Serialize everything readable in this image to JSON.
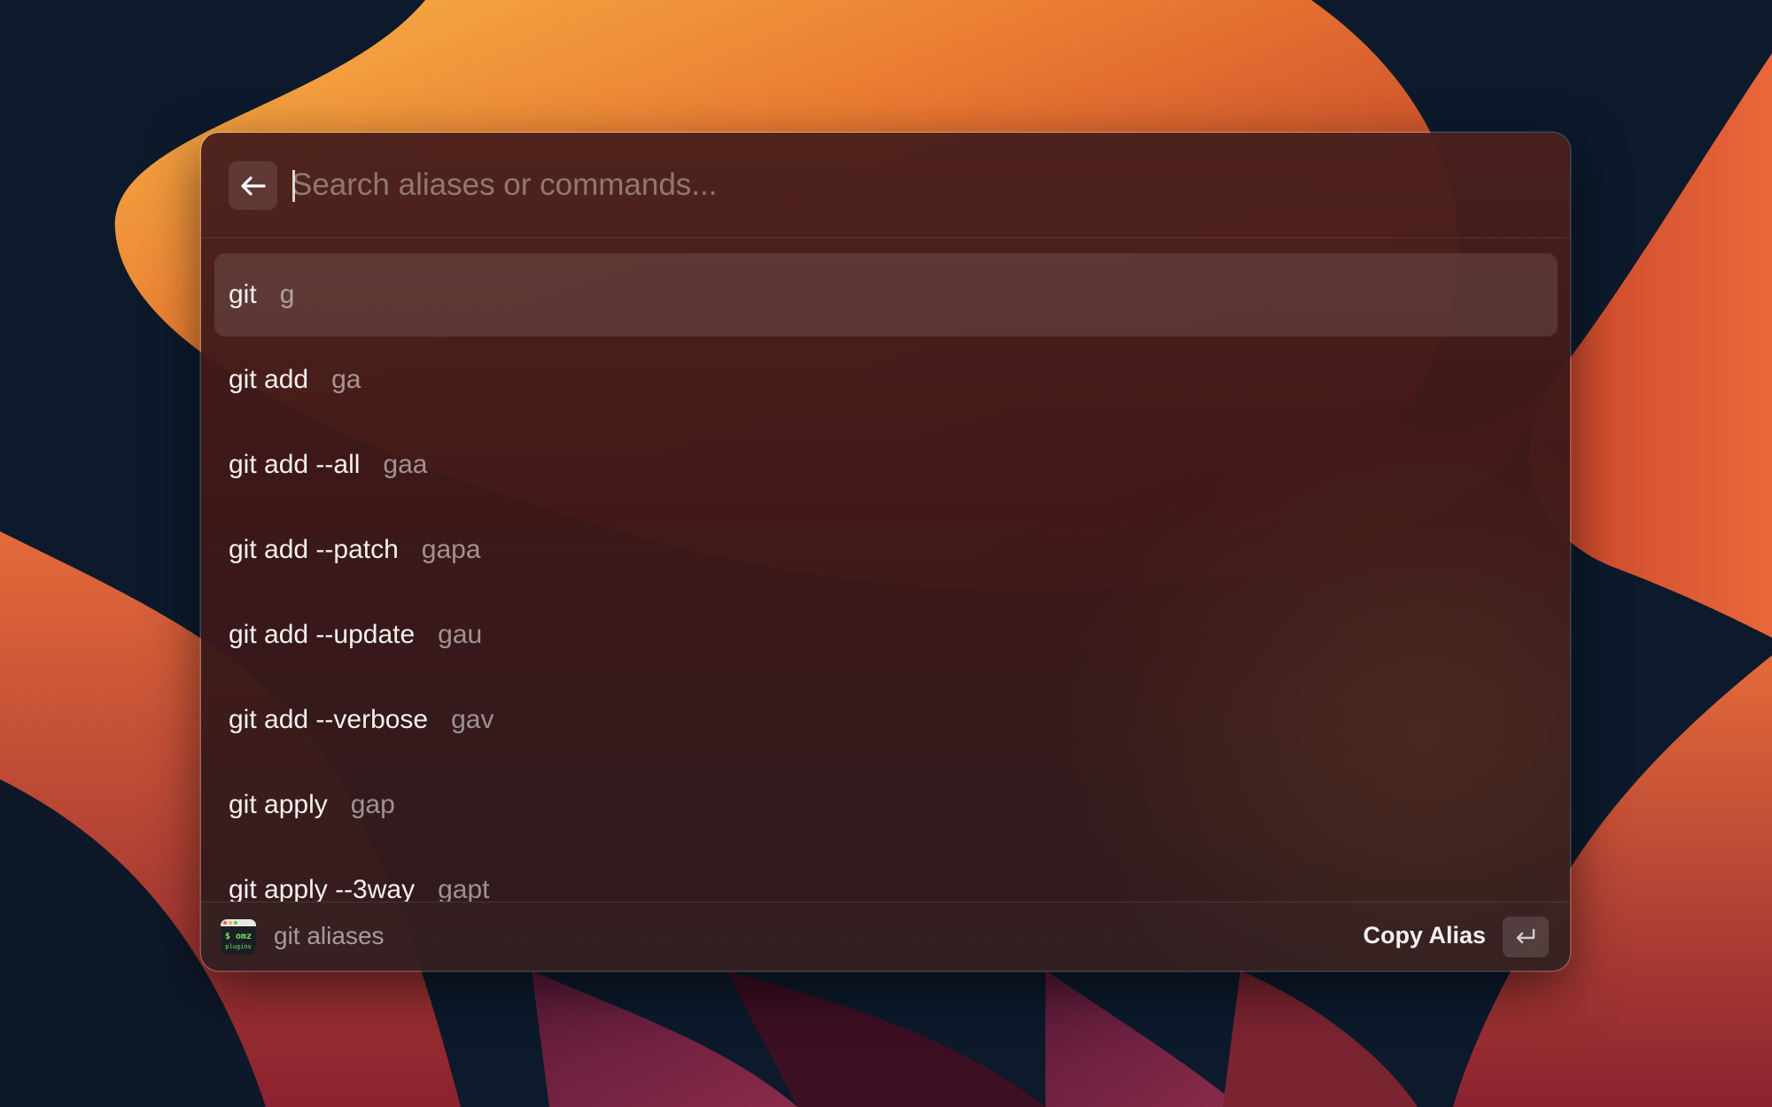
{
  "search": {
    "placeholder": "Search aliases or commands...",
    "value": ""
  },
  "items": [
    {
      "command": "git",
      "alias": "g",
      "selected": true
    },
    {
      "command": "git add",
      "alias": "ga",
      "selected": false
    },
    {
      "command": "git add --all",
      "alias": "gaa",
      "selected": false
    },
    {
      "command": "git add --patch",
      "alias": "gapa",
      "selected": false
    },
    {
      "command": "git add --update",
      "alias": "gau",
      "selected": false
    },
    {
      "command": "git add --verbose",
      "alias": "gav",
      "selected": false
    },
    {
      "command": "git apply",
      "alias": "gap",
      "selected": false
    },
    {
      "command": "git apply --3way",
      "alias": "gapt",
      "selected": false
    }
  ],
  "footer": {
    "icon_line1": "$ omz",
    "icon_line2": "plugins",
    "title": "git aliases",
    "action_label": "Copy Alias",
    "action_key": "↵"
  },
  "icons": {
    "back": "arrow-left-icon",
    "extension": "omz-plugins-icon",
    "enter": "return-key-icon"
  },
  "colors": {
    "panel": "#4a201c",
    "selection": "#5e3a38"
  }
}
